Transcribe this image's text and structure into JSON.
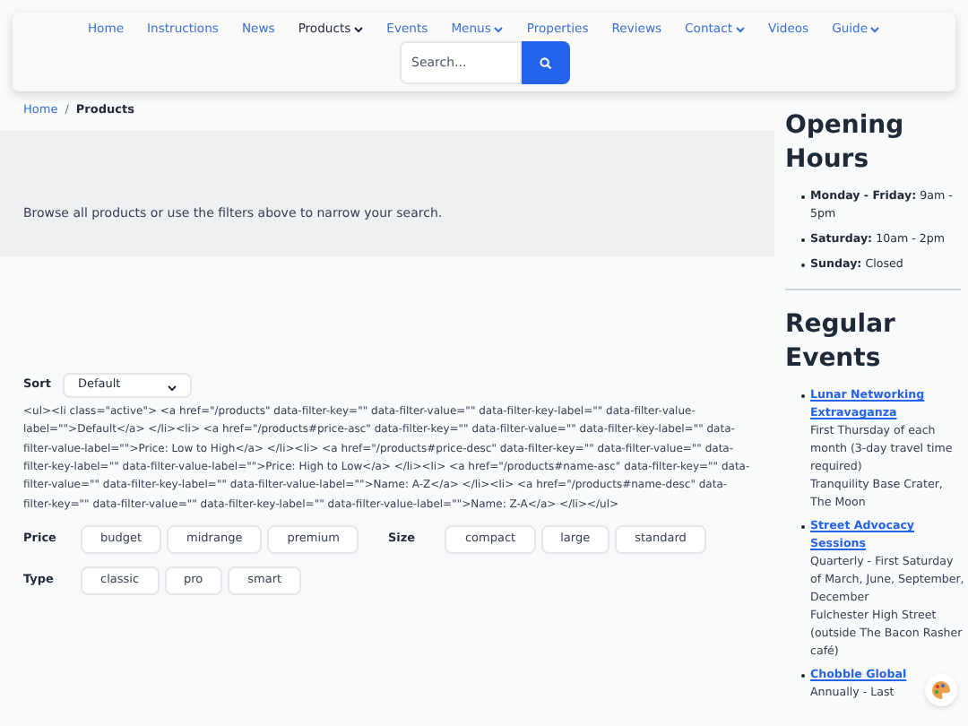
{
  "nav": {
    "items": [
      {
        "label": "Home",
        "selected": false,
        "dropdown": false
      },
      {
        "label": "Instructions",
        "selected": false,
        "dropdown": false
      },
      {
        "label": "News",
        "selected": false,
        "dropdown": false
      },
      {
        "label": "Products",
        "selected": true,
        "dropdown": true
      },
      {
        "label": "Events",
        "selected": false,
        "dropdown": false
      },
      {
        "label": "Menus",
        "selected": false,
        "dropdown": true
      },
      {
        "label": "Properties",
        "selected": false,
        "dropdown": false
      },
      {
        "label": "Reviews",
        "selected": false,
        "dropdown": false
      },
      {
        "label": "Contact",
        "selected": false,
        "dropdown": true
      },
      {
        "label": "Videos",
        "selected": false,
        "dropdown": false
      },
      {
        "label": "Guide",
        "selected": false,
        "dropdown": true
      }
    ],
    "search": {
      "placeholder": "Search..."
    }
  },
  "breadcrumb": {
    "items": [
      "Home",
      "Products"
    ],
    "separator": "/"
  },
  "intro": "Browse all products or use the filters above to narrow your search.",
  "sort": {
    "label": "Sort",
    "value": "Default"
  },
  "raw_html": "<ul><li class=\"active\"> <a href=\"/products\" data-filter-key=\"\" data-filter-value=\"\" data-filter-key-label=\"\" data-filter-value-label=\"\">Default</a> </li><li> <a href=\"/products#price-asc\" data-filter-key=\"\" data-filter-value=\"\" data-filter-key-label=\"\" data-filter-value-label=\"\">Price: Low to High</a> </li><li> <a href=\"/products#price-desc\" data-filter-key=\"\" data-filter-value=\"\" data-filter-key-label=\"\" data-filter-value-label=\"\">Price: High to Low</a> </li><li> <a href=\"/products#name-asc\" data-filter-key=\"\" data-filter-value=\"\" data-filter-key-label=\"\" data-filter-value-label=\"\">Name: A-Z</a> </li><li> <a href=\"/products#name-desc\" data-filter-key=\"\" data-filter-value=\"\" data-filter-key-label=\"\" data-filter-value-label=\"\">Name: Z-A</a> </li></ul>",
  "filter_rows": [
    {
      "groups": [
        {
          "label": "Price",
          "options": [
            "budget",
            "midrange",
            "premium"
          ]
        },
        {
          "label": "Size",
          "options": [
            "compact",
            "large",
            "standard"
          ]
        }
      ]
    },
    {
      "groups": [
        {
          "label": "Type",
          "options": [
            "classic",
            "pro",
            "smart"
          ]
        }
      ]
    }
  ],
  "sidebar": {
    "hours": {
      "title": "Opening Hours",
      "items": [
        {
          "day": "Monday - Friday:",
          "time": "9am - 5pm"
        },
        {
          "day": "Saturday:",
          "time": "10am - 2pm"
        },
        {
          "day": "Sunday:",
          "time": "Closed"
        }
      ]
    },
    "events": {
      "title": "Regular Events",
      "items": [
        {
          "name": "Lunar Networking Extravaganza",
          "lines": [
            "First Thursday of each month (3-day travel time required)",
            "Tranquility Base Crater, The Moon"
          ]
        },
        {
          "name": "Street Advocacy Sessions",
          "lines": [
            "Quarterly - First Saturday of March, June, September, December",
            "Fulchester High Street (outside The Bacon Rasher café)"
          ]
        },
        {
          "name": "Chobble Global",
          "lines": [
            "Annually - Last"
          ]
        }
      ]
    }
  }
}
